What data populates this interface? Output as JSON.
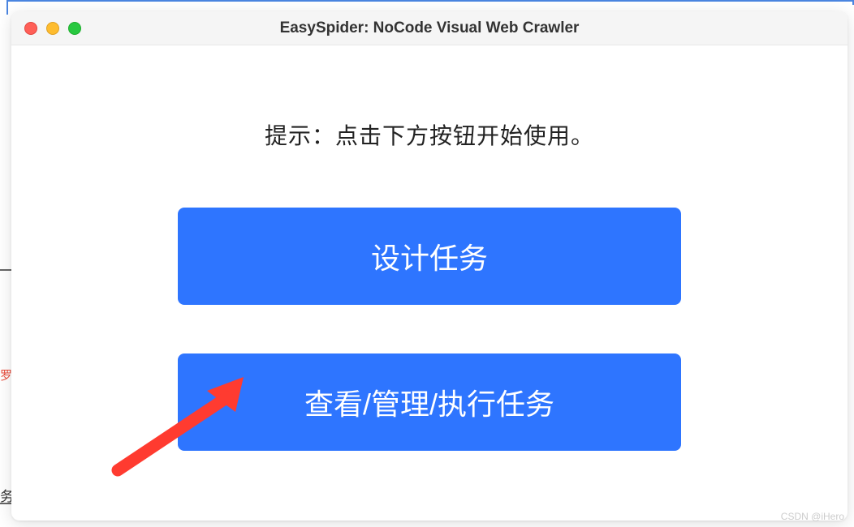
{
  "window": {
    "title": "EasySpider: NoCode Visual Web Crawler"
  },
  "hint": "提示：点击下方按钮开始使用。",
  "buttons": {
    "design": "设计任务",
    "manage": "查看/管理/执行任务"
  },
  "background": {
    "red_fragment": "罗",
    "bottom_char": "务"
  },
  "watermark": "CSDN @iHero",
  "colors": {
    "button_bg": "#2e75ff",
    "arrow": "#ff3b30"
  }
}
